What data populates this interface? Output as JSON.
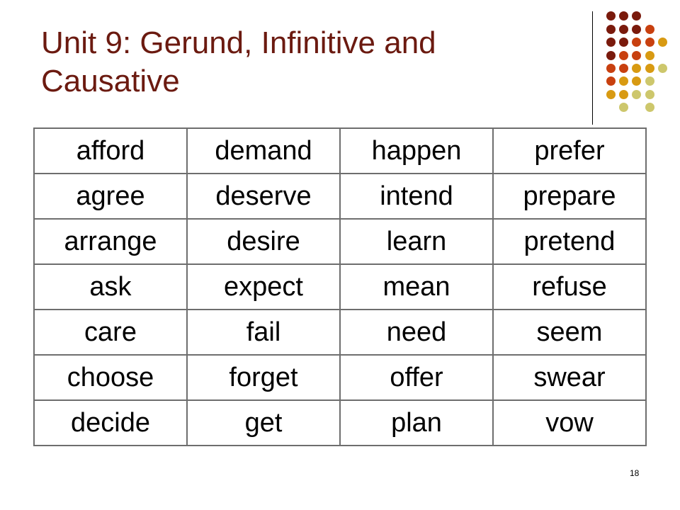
{
  "slide": {
    "title_line1": "Unit 9: Gerund, Infinitive and",
    "title_line2": "Causative",
    "page_number": "18"
  },
  "decoration": {
    "colors": {
      "dark": "#7a1a0c",
      "red": "#c8400f",
      "orange": "#d89a12",
      "olive": "#cdc76c"
    },
    "grid": [
      [
        "dark",
        "dark",
        "dark",
        null,
        null
      ],
      [
        "dark",
        "dark",
        "dark",
        "red",
        null
      ],
      [
        "dark",
        "dark",
        "red",
        "red",
        "orange"
      ],
      [
        "dark",
        "red",
        "red",
        "orange",
        null
      ],
      [
        "red",
        "red",
        "orange",
        "orange",
        "olive"
      ],
      [
        "red",
        "orange",
        "orange",
        "olive",
        null
      ],
      [
        "orange",
        "orange",
        "olive",
        "olive",
        null
      ],
      [
        null,
        "olive",
        null,
        "olive",
        null
      ]
    ]
  },
  "table": {
    "rows": [
      [
        "afford",
        "demand",
        "happen",
        "prefer"
      ],
      [
        "agree",
        "deserve",
        "intend",
        "prepare"
      ],
      [
        "arrange",
        "desire",
        "learn",
        "pretend"
      ],
      [
        "ask",
        "expect",
        "mean",
        "refuse"
      ],
      [
        "care",
        "fail",
        "need",
        "seem"
      ],
      [
        "choose",
        "forget",
        "offer",
        "swear"
      ],
      [
        "decide",
        "get",
        "plan",
        "vow"
      ]
    ]
  }
}
